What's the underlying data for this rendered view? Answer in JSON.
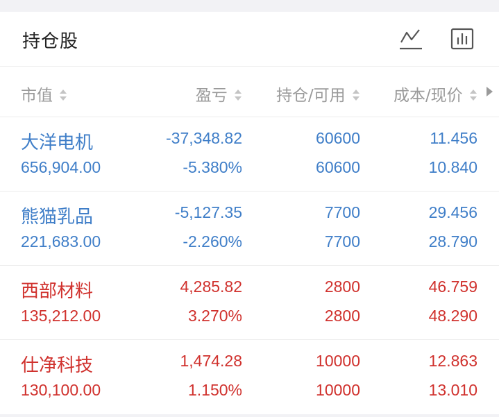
{
  "header": {
    "title": "持仓股",
    "line_chart_icon": "line-chart-icon",
    "bar_chart_icon": "bar-chart-icon"
  },
  "columns": {
    "market_value": "市值",
    "profit_loss": "盈亏",
    "position_available": "持仓/可用",
    "cost_price": "成本/现价"
  },
  "colors": {
    "gain": "#d0312d",
    "loss": "#3f7ec8"
  },
  "holdings": [
    {
      "name": "大洋电机",
      "market_value": "656,904.00",
      "profit": "-37,348.82",
      "profit_pct": "-5.380%",
      "position": "60600",
      "available": "60600",
      "cost": "11.456",
      "price": "10.840",
      "trend": "loss"
    },
    {
      "name": "熊猫乳品",
      "market_value": "221,683.00",
      "profit": "-5,127.35",
      "profit_pct": "-2.260%",
      "position": "7700",
      "available": "7700",
      "cost": "29.456",
      "price": "28.790",
      "trend": "loss"
    },
    {
      "name": "西部材料",
      "market_value": "135,212.00",
      "profit": "4,285.82",
      "profit_pct": "3.270%",
      "position": "2800",
      "available": "2800",
      "cost": "46.759",
      "price": "48.290",
      "trend": "gain"
    },
    {
      "name": "仕净科技",
      "market_value": "130,100.00",
      "profit": "1,474.28",
      "profit_pct": "1.150%",
      "position": "10000",
      "available": "10000",
      "cost": "12.863",
      "price": "13.010",
      "trend": "gain"
    }
  ]
}
